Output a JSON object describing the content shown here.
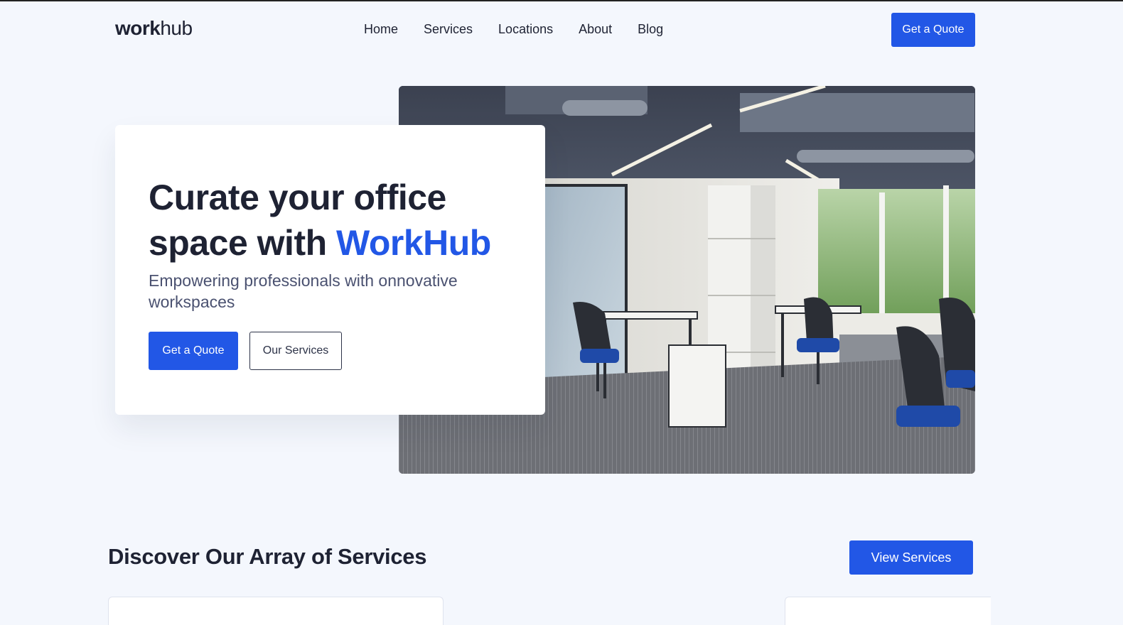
{
  "header": {
    "logo_bold": "work",
    "logo_light": "hub",
    "nav": [
      "Home",
      "Services",
      "Locations",
      "About",
      "Blog"
    ],
    "quote_label": "Get a Quote"
  },
  "hero": {
    "title_line1": "Curate your office",
    "title_line2_prefix": "space with ",
    "title_accent": "WorkHub",
    "subtitle": "Empowering professionals with onnovative workspaces",
    "primary_label": "Get a Quote",
    "secondary_label": "Our Services"
  },
  "services": {
    "title": "Discover Our Array of Services",
    "view_label": "View Services"
  },
  "colors": {
    "accent": "#2257e6",
    "background": "#f4f7fd",
    "text": "#1e2233"
  }
}
